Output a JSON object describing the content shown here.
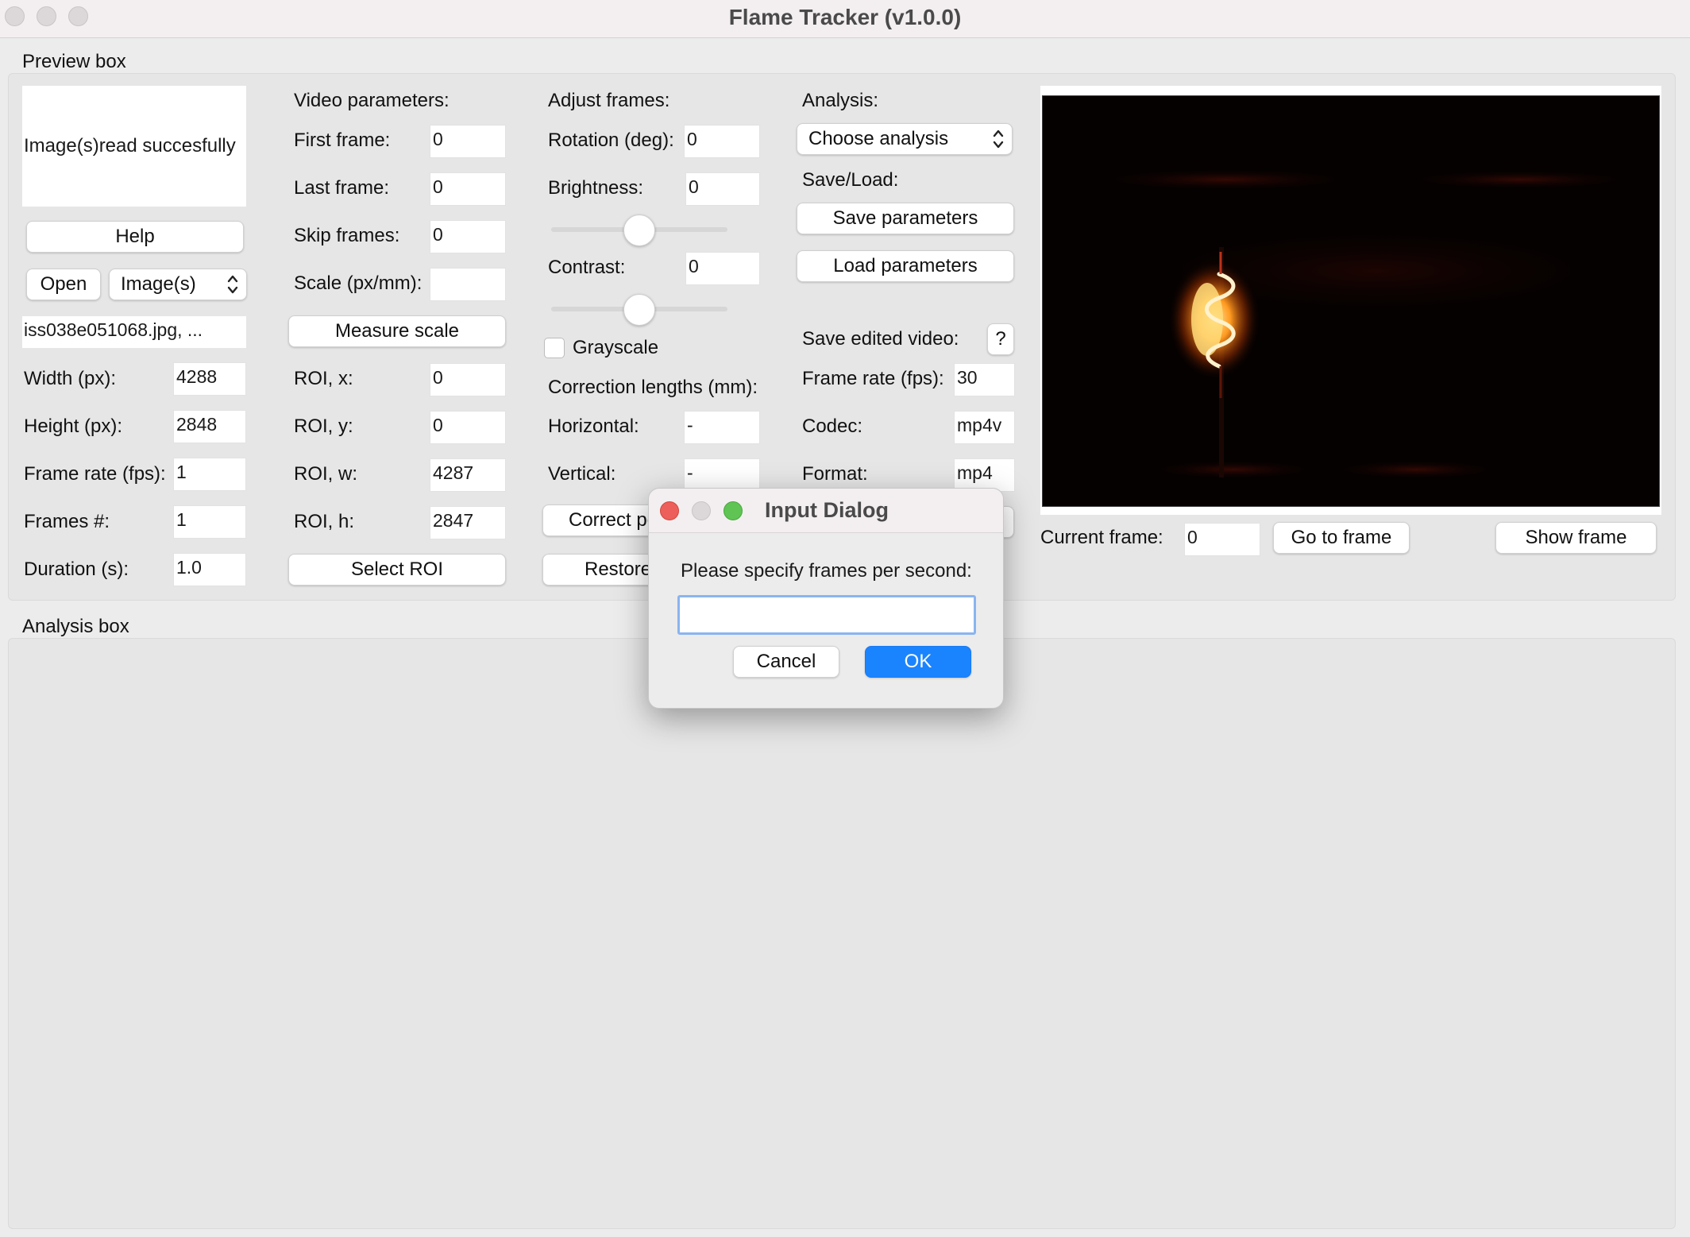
{
  "window": {
    "title": "Flame Tracker (v1.0.0)"
  },
  "preview_box": {
    "title": "Preview box",
    "status": "Image(s)read succesfully",
    "help_label": "Help",
    "open_label": "Open",
    "source_type": "Image(s)",
    "file_name": "iss038e051068.jpg, ...",
    "info": [
      {
        "label": "Width (px):",
        "value": "4288"
      },
      {
        "label": "Height (px):",
        "value": "2848"
      },
      {
        "label": "Frame rate (fps):",
        "value": "1"
      },
      {
        "label": "Frames #:",
        "value": "1"
      },
      {
        "label": "Duration (s):",
        "value": "1.0"
      }
    ]
  },
  "video_params": {
    "title": "Video parameters:",
    "first_frame": {
      "label": "First frame:",
      "value": "0"
    },
    "last_frame": {
      "label": "Last frame:",
      "value": "0"
    },
    "skip_frames": {
      "label": "Skip frames:",
      "value": "0"
    },
    "scale": {
      "label": "Scale (px/mm):",
      "value": ""
    },
    "measure_scale_label": "Measure scale",
    "roi_x": {
      "label": "ROI, x:",
      "value": "0"
    },
    "roi_y": {
      "label": "ROI, y:",
      "value": "0"
    },
    "roi_w": {
      "label": "ROI, w:",
      "value": "4287"
    },
    "roi_h": {
      "label": "ROI, h:",
      "value": "2847"
    },
    "select_roi_label": "Select ROI"
  },
  "adjust_frames": {
    "title": "Adjust frames:",
    "rotation": {
      "label": "Rotation (deg):",
      "value": "0"
    },
    "brightness": {
      "label": "Brightness:",
      "value": "0",
      "slider_level": 0.5
    },
    "contrast": {
      "label": "Contrast:",
      "value": "0",
      "slider_level": 0.5
    },
    "grayscale_label": "Grayscale",
    "grayscale_checked": false,
    "correction_title": "Correction lengths (mm):",
    "horizontal": {
      "label": "Horizontal:",
      "value": "-"
    },
    "vertical": {
      "label": "Vertical:",
      "value": "-"
    },
    "correct_label": "Correct pe",
    "restore_label": "Restore"
  },
  "analysis": {
    "title": "Analysis:",
    "choose_label": "Choose analysis",
    "save_load_title": "Save/Load:",
    "save_params_label": "Save parameters",
    "load_params_label": "Load parameters",
    "save_video_title": "Save edited video:",
    "help_q": "?",
    "frame_rate": {
      "label": "Frame rate (fps):",
      "value": "30"
    },
    "codec": {
      "label": "Codec:",
      "value": "mp4v"
    },
    "format": {
      "label": "Format:",
      "value": "mp4"
    }
  },
  "frame_nav": {
    "current_frame_label": "Current frame:",
    "current_frame_value": "0",
    "go_to_label": "Go to frame",
    "show_frame_label": "Show frame"
  },
  "analysis_box": {
    "title": "Analysis box"
  },
  "dialog": {
    "title": "Input Dialog",
    "prompt": "Please specify frames per second:",
    "input_value": "",
    "cancel_label": "Cancel",
    "ok_label": "OK"
  },
  "colors": {
    "accent": "#1a84ff",
    "close": "#ec5f5a",
    "minimize": "#dcd8d9",
    "maximize": "#5fc453"
  }
}
